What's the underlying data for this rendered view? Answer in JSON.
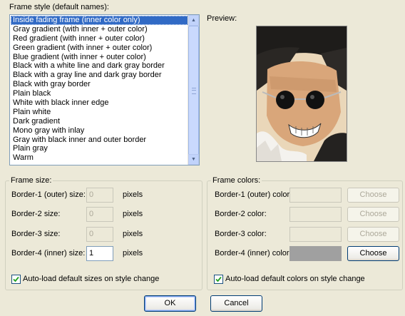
{
  "frame_style": {
    "title": "Frame style (default names):",
    "selected_index": 0,
    "items": [
      "Inside fading frame (inner color only)",
      "Gray gradient (with inner + outer color)",
      "Red gradient (with inner + outer color)",
      "Green gradient (with inner + outer color)",
      "Blue gradient (with inner + outer color)",
      "Black with a white line and dark gray border",
      "Black with a gray line and dark gray border",
      "Black with gray border",
      "Plain black",
      "White with black inner edge",
      "Plain white",
      "Dark gradient",
      "Mono gray with inlay",
      "Gray with black inner and outer border",
      "Plain gray",
      "Warm"
    ]
  },
  "preview": {
    "label": "Preview:"
  },
  "frame_size": {
    "title": "Frame size:",
    "unit": "pixels",
    "rows": [
      {
        "label": "Border-1 (outer) size:",
        "value": "0",
        "enabled": false
      },
      {
        "label": "Border-2 size:",
        "value": "0",
        "enabled": false
      },
      {
        "label": "Border-3 size:",
        "value": "0",
        "enabled": false
      },
      {
        "label": "Border-4 (inner) size:",
        "value": "1",
        "enabled": true
      }
    ],
    "autoload_label": "Auto-load default sizes on style change",
    "autoload_checked": true
  },
  "frame_colors": {
    "title": "Frame colors:",
    "choose_label": "Choose",
    "rows": [
      {
        "label": "Border-1 (outer) color:",
        "color": "#ece9d8",
        "enabled": false
      },
      {
        "label": "Border-2 color:",
        "color": "#ece9d8",
        "enabled": false
      },
      {
        "label": "Border-3 color:",
        "color": "#ece9d8",
        "enabled": false
      },
      {
        "label": "Border-4 (inner) color:",
        "color": "#a0a0a0",
        "enabled": true
      }
    ],
    "autoload_label": "Auto-load default colors on style change",
    "autoload_checked": true
  },
  "buttons": {
    "ok": "OK",
    "cancel": "Cancel"
  }
}
